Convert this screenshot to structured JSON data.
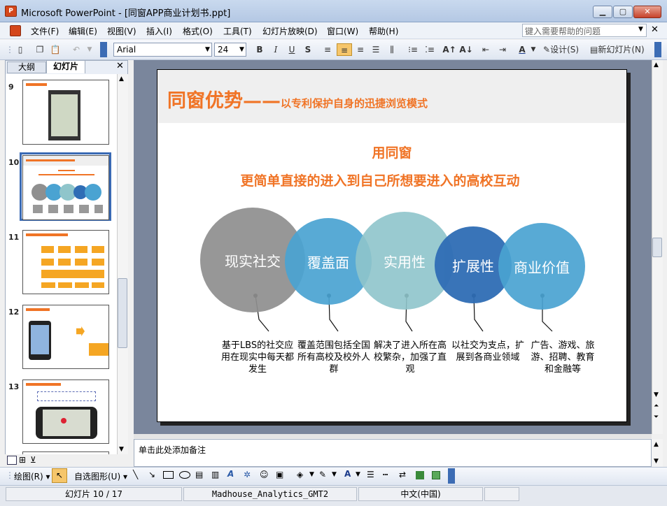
{
  "window": {
    "title": "Microsoft PowerPoint - [同窗APP商业计划书.ppt]",
    "app_icon": "powerpoint-icon"
  },
  "menu": {
    "items": [
      "文件(F)",
      "编辑(E)",
      "视图(V)",
      "插入(I)",
      "格式(O)",
      "工具(T)",
      "幻灯片放映(D)",
      "窗口(W)",
      "帮助(H)"
    ],
    "help_placeholder": "键入需要帮助的问题"
  },
  "toolbar": {
    "font": "Arial",
    "size": "24",
    "design_label": "设计(S)",
    "new_slide_label": "新幻灯片(N)"
  },
  "left_panel": {
    "tabs": [
      "大纲",
      "幻灯片"
    ],
    "slides": [
      {
        "num": "9"
      },
      {
        "num": "10"
      },
      {
        "num": "11"
      },
      {
        "num": "12"
      },
      {
        "num": "13"
      }
    ]
  },
  "slide": {
    "title": "同窗优势——",
    "title_sub": "以专利保护自身的迅捷浏览模式",
    "subtitle1": "用同窗",
    "subtitle2": "更简单直接的进入到自己所想要进入的高校互动",
    "circles": [
      {
        "label": "现实社交",
        "color": "#8f8f8f",
        "caption": "基于LBS的社交应用在现实中每天都发生"
      },
      {
        "label": "覆盖面",
        "color": "#4aa3d2",
        "caption": "覆盖范围包括全国所有高校及校外人群"
      },
      {
        "label": "实用性",
        "color": "#8fc5cb",
        "caption": "解决了进入所在高校繁杂，加强了直观"
      },
      {
        "label": "扩展性",
        "color": "#2f6db5",
        "caption": "以社交为支点，扩展到各商业领域"
      },
      {
        "label": "商业价值",
        "color": "#4aa3d2",
        "caption": "广告、游戏、旅游、招聘、教育和金融等"
      }
    ]
  },
  "notes": {
    "placeholder": "单击此处添加备注"
  },
  "drawbar": {
    "draw_label": "绘图(R)",
    "autoshape_label": "自选图形(U)"
  },
  "status": {
    "slide": "幻灯片 10 / 17",
    "design": "Madhouse_Analytics_GMT2",
    "lang": "中文(中国)"
  }
}
